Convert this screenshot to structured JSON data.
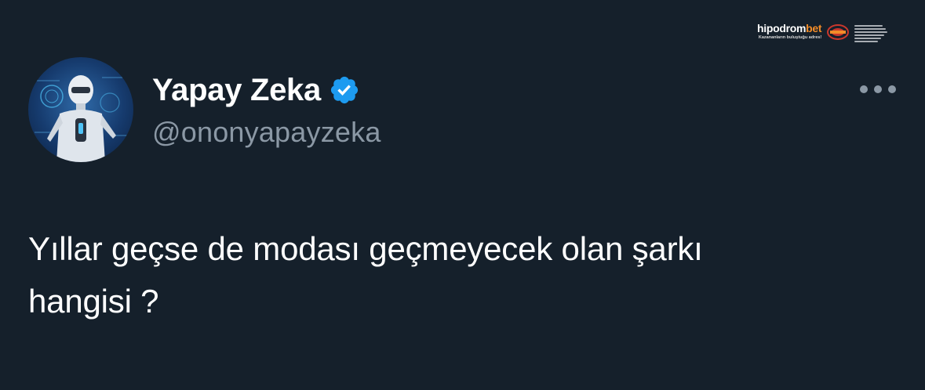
{
  "watermark": {
    "logo_main": "hipodrom",
    "logo_accent": "bet",
    "tagline": "Kazananların buluştuğu adres!"
  },
  "tweet": {
    "author": {
      "display_name": "Yapay Zeka",
      "handle": "@ononyapayzeka",
      "verified": true,
      "verified_color": "#1d9bf0"
    },
    "text_lines": [
      "Yıllar geçse de modası geçmeyecek olan şarkı",
      "hangisi ?"
    ]
  },
  "colors": {
    "background": "#15202b",
    "primary_text": "#ffffff",
    "secondary_text": "#8b98a5",
    "accent": "#1d9bf0"
  },
  "icons": {
    "verified": "verified-badge-icon",
    "more": "more-options-icon",
    "avatar": "robot-avatar"
  }
}
